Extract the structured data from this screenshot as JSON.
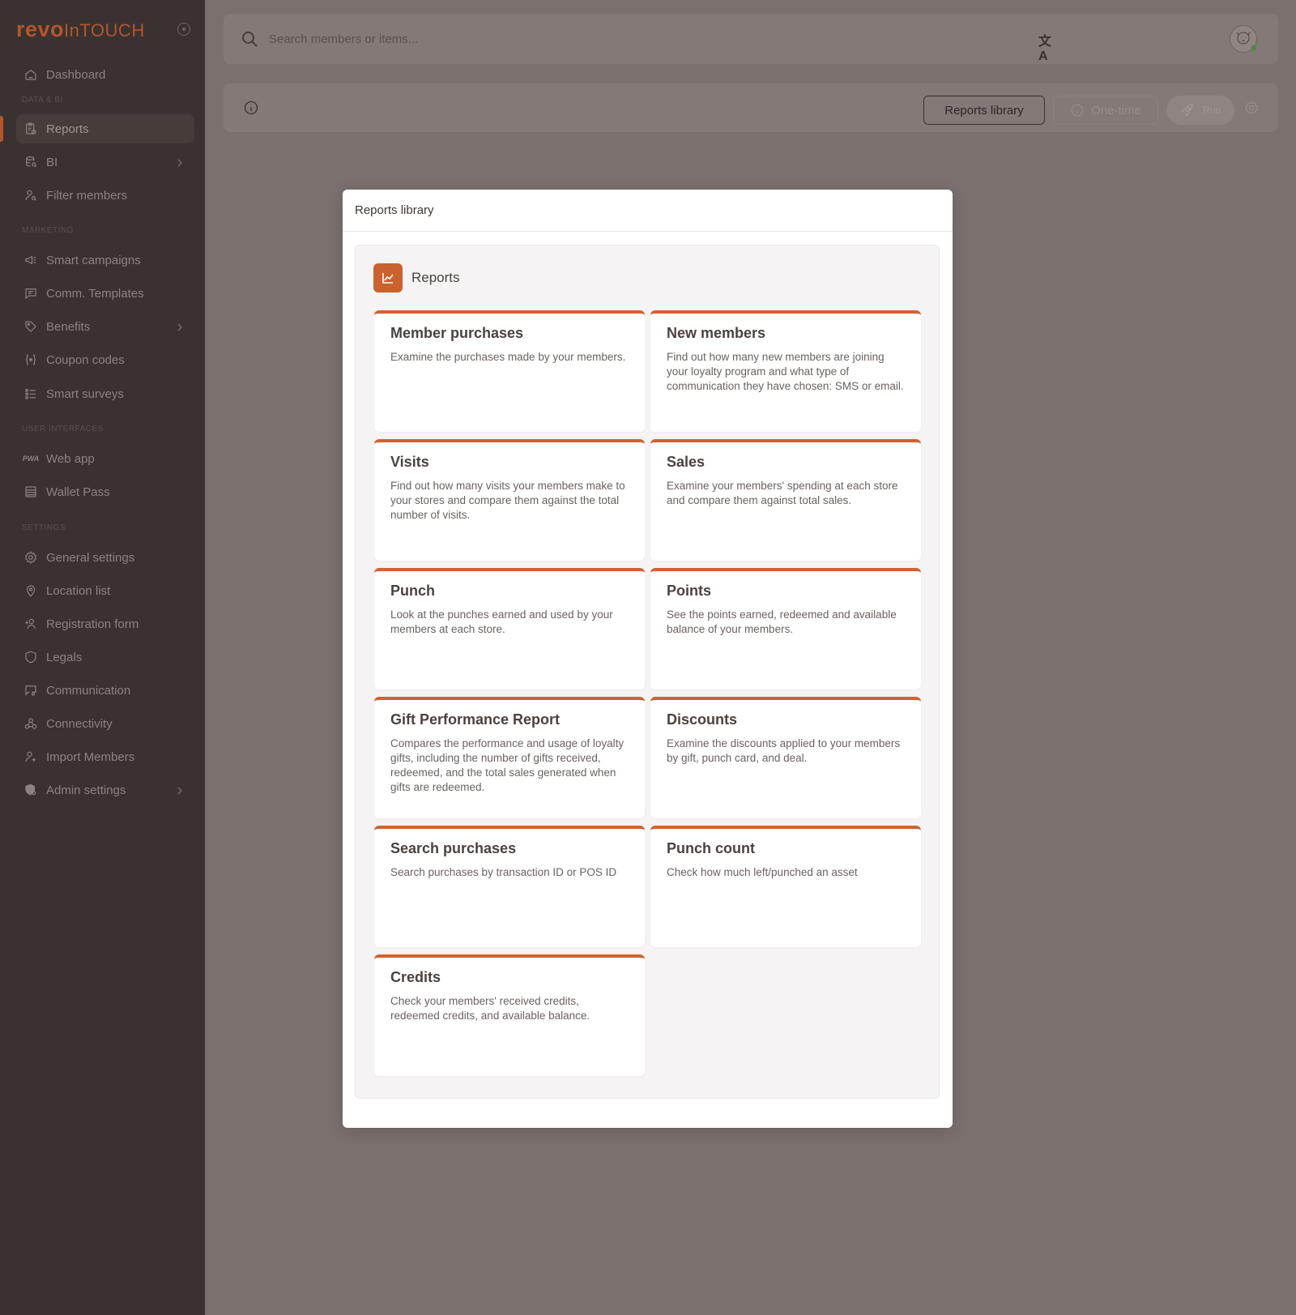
{
  "app": {
    "logo_bold": "revo",
    "logo_light": "InTOUCH"
  },
  "sidebar": {
    "dashboard": "Dashboard",
    "sections": {
      "data_bi": "DATA & BI",
      "marketing": "MARKETING",
      "user_interfaces": "USER INTERFACES",
      "settings": "SETTINGS"
    },
    "items": {
      "reports": "Reports",
      "bi": "BI",
      "filter_members": "Filter members",
      "smart_campaigns": "Smart campaigns",
      "comm_templates": "Comm. Templates",
      "benefits": "Benefits",
      "coupon_codes": "Coupon codes",
      "smart_surveys": "Smart surveys",
      "web_app": "Web app",
      "wallet_pass": "Wallet Pass",
      "general_settings": "General settings",
      "location_list": "Location list",
      "registration_form": "Registration form",
      "legals": "Legals",
      "communication": "Communication",
      "connectivity": "Connectivity",
      "import_members": "Import Members",
      "admin_settings": "Admin settings"
    },
    "pwa_badge": "PWA"
  },
  "topbar": {
    "search_placeholder": "Search members or items...",
    "translate_glyph": "文A"
  },
  "toolbar": {
    "reports_library": "Reports library",
    "one_time": "One-time",
    "run": "Run"
  },
  "modal": {
    "title": "Reports library",
    "group_title": "Reports",
    "cards": [
      {
        "title": "Member purchases",
        "desc": "Examine the purchases made by your members."
      },
      {
        "title": "New members",
        "desc": "Find out how many new members are joining your loyalty program and what type of communication they have chosen: SMS or email."
      },
      {
        "title": "Visits",
        "desc": "Find out how many visits your members make to your stores and compare them against the total number of visits."
      },
      {
        "title": "Sales",
        "desc": "Examine your members' spending at each store and compare them against total sales."
      },
      {
        "title": "Punch",
        "desc": "Look at the punches earned and used by your members at each store."
      },
      {
        "title": "Points",
        "desc": "See the points earned, redeemed and available balance of your members."
      },
      {
        "title": "Gift Performance Report",
        "desc": "Compares the performance and usage of loyalty gifts, including the number of gifts received, redeemed, and the total sales generated when gifts are redeemed."
      },
      {
        "title": "Discounts",
        "desc": "Examine the discounts applied to your members by gift, punch card, and deal."
      },
      {
        "title": "Search purchases",
        "desc": "Search purchases by transaction ID or POS ID"
      },
      {
        "title": "Punch count",
        "desc": "Check how much left/punched an asset"
      },
      {
        "title": "Credits",
        "desc": "Check your members' received credits, redeemed credits, and available balance."
      }
    ]
  },
  "colors": {
    "accent": "#d06233",
    "sidebar_bg": "#3a3230",
    "overlay_bg": "#7a706e"
  }
}
